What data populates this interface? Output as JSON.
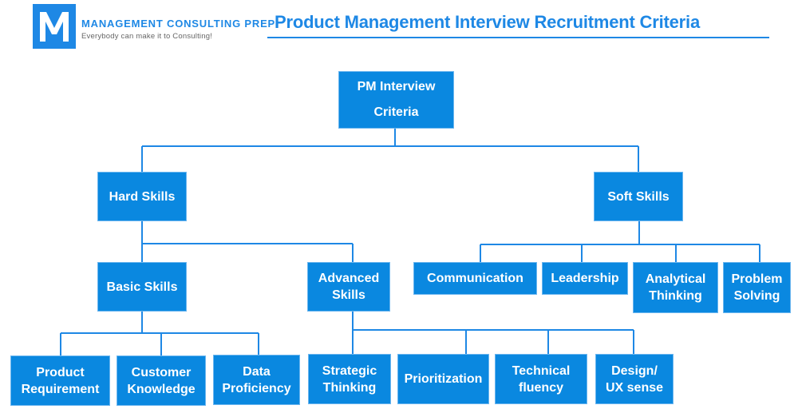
{
  "brand": {
    "logo_letter": "M",
    "name": "MANAGEMENT CONSULTING PREP",
    "tagline": "Everybody can make it to Consulting!"
  },
  "title": "Product Management Interview Recruitment Criteria",
  "colors": {
    "accent": "#1e88e5",
    "node_fill": "#0a88e0",
    "node_text": "#ffffff"
  },
  "tree": {
    "root": "PM Interview\nCriteria",
    "hard_skills": {
      "label": "Hard Skills",
      "basic": {
        "label": "Basic Skills",
        "children": [
          "Product\nRequirement",
          "Customer\nKnowledge",
          "Data\nProficiency"
        ]
      },
      "advanced": {
        "label": "Advanced\nSkills",
        "children": [
          "Strategic\nThinking",
          "Prioritization",
          "Technical\nfluency",
          "Design/\nUX sense"
        ]
      }
    },
    "soft_skills": {
      "label": "Soft Skills",
      "children": [
        "Communication",
        "Leadership",
        "Analytical\nThinking",
        "Problem\nSolving"
      ]
    }
  }
}
